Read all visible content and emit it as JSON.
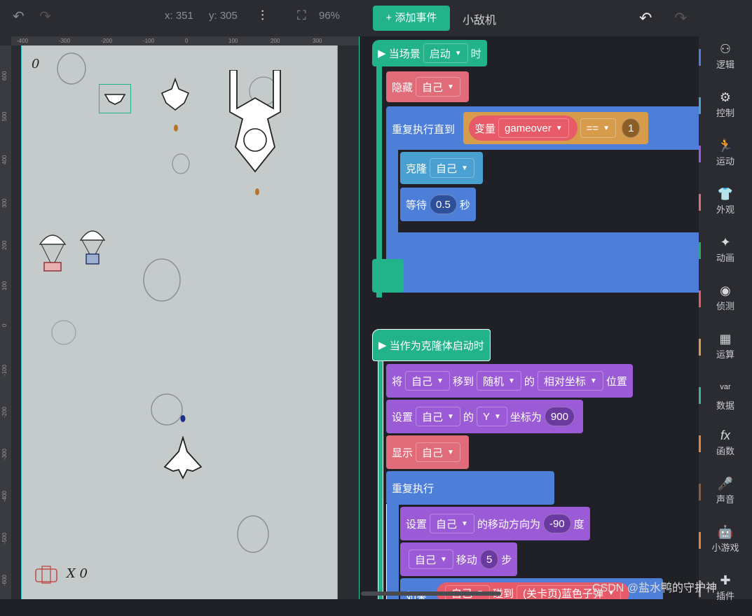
{
  "stage": {
    "coord_x": "x: 351",
    "coord_y": "y: 305",
    "zoom": "96%",
    "score": "0",
    "lives_label": "X 0",
    "ruler_top": [
      "-400",
      "-300",
      "-200",
      "-100",
      "0",
      "100",
      "200",
      "300"
    ],
    "ruler_left": [
      "600",
      "500",
      "400",
      "300",
      "200",
      "100",
      "0",
      "-100",
      "-200",
      "-300",
      "-400",
      "-500",
      "-600"
    ]
  },
  "header": {
    "add_event": "添加事件",
    "sprite_name": "小敌机"
  },
  "blocks": {
    "when_scene": "当场景",
    "when_scene_opt": "启动",
    "when_scene_suffix": "时",
    "hide": "隐藏",
    "self": "自己",
    "repeat_until": "重复执行直到",
    "var_label": "变量",
    "var_name": "gameover",
    "op_eq": "==",
    "num_1": "1",
    "clone": "克隆",
    "wait": "等待",
    "wait_val": "0.5",
    "seconds": "秒",
    "when_clone": "当作为克隆体启动时",
    "move_to_pre": "将",
    "move_to": "移到",
    "random": "随机",
    "of": "的",
    "relative": "相对坐标",
    "position": "位置",
    "set": "设置",
    "y_axis": "Y",
    "coord_as": "坐标为",
    "y_val": "900",
    "show": "显示",
    "forever": "重复执行",
    "direction_label": "的移动方向为",
    "direction_val": "-90",
    "degree": "度",
    "move": "移动",
    "move_val": "5",
    "steps": "步",
    "if_label": "如果",
    "touch": "碰到",
    "bullet_opt": "(关卡页)蓝色子弹"
  },
  "categories": [
    {
      "label": "逻辑",
      "icon": "logic-icon",
      "color": "#4d7fd9"
    },
    {
      "label": "控制",
      "icon": "control-icon",
      "color": "#4aa0d0"
    },
    {
      "label": "运动",
      "icon": "motion-icon",
      "color": "#9b5bd6"
    },
    {
      "label": "外观",
      "icon": "looks-icon",
      "color": "#e06c7a"
    },
    {
      "label": "动画",
      "icon": "animation-icon",
      "color": "#22b35a"
    },
    {
      "label": "侦测",
      "icon": "sensing-icon",
      "color": "#e75a68"
    },
    {
      "label": "运算",
      "icon": "operator-icon",
      "color": "#d79c4b"
    },
    {
      "label": "数据",
      "icon": "data-icon",
      "color": "#3ab39a"
    },
    {
      "label": "函数",
      "icon": "function-icon",
      "color": "#e0843f"
    },
    {
      "label": "声音",
      "icon": "sound-icon",
      "color": "#8a5a3c"
    },
    {
      "label": "小游戏",
      "icon": "minigame-icon",
      "color": "#e0843f"
    },
    {
      "label": "插件",
      "icon": "plugin-icon",
      "color": "#999999"
    }
  ],
  "watermark": "CSDN @盐水鸭的守护神"
}
